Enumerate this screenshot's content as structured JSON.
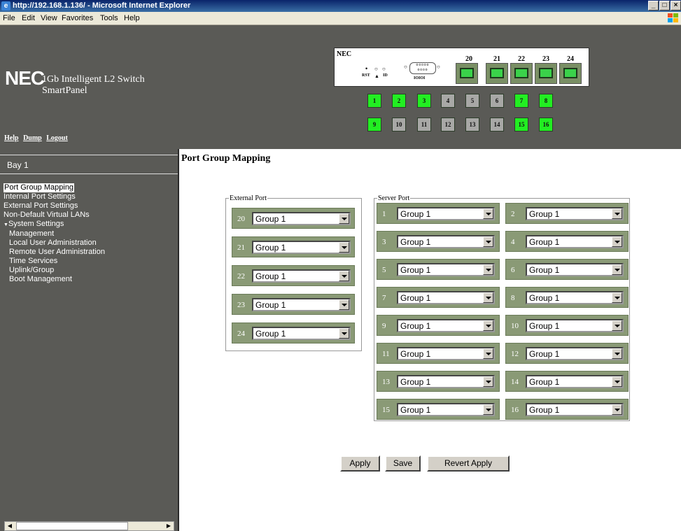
{
  "window": {
    "title": "http://192.168.1.136/ - Microsoft Internet Explorer",
    "min": "_",
    "max": "□",
    "close": "×"
  },
  "menu": [
    "File",
    "Edit",
    "View",
    "Favorites",
    "Tools",
    "Help"
  ],
  "header": {
    "logo": "NEC",
    "product_line1": "1Gb Intelligent L2 Switch",
    "product_line2": "SmartPanel",
    "links": [
      "Help",
      "Dump",
      "Logout"
    ]
  },
  "panel": {
    "brand": "NEC",
    "rst": "RST",
    "id": "ID",
    "serial_text": "IOIOI",
    "external_ports": [
      "20",
      "21",
      "22",
      "23",
      "24"
    ],
    "server_ports": [
      {
        "n": "1",
        "up": true
      },
      {
        "n": "2",
        "up": true
      },
      {
        "n": "3",
        "up": true
      },
      {
        "n": "4",
        "up": false
      },
      {
        "n": "5",
        "up": false
      },
      {
        "n": "6",
        "up": false
      },
      {
        "n": "7",
        "up": true
      },
      {
        "n": "8",
        "up": true
      },
      {
        "n": "9",
        "up": true
      },
      {
        "n": "10",
        "up": false
      },
      {
        "n": "11",
        "up": false
      },
      {
        "n": "12",
        "up": false
      },
      {
        "n": "13",
        "up": false
      },
      {
        "n": "14",
        "up": false
      },
      {
        "n": "15",
        "up": true
      },
      {
        "n": "16",
        "up": true
      }
    ],
    "colors": {
      "link_up": "#22ee22",
      "link_down": "#a8a8a6"
    }
  },
  "sidebar": {
    "bay": "Bay 1",
    "items": [
      {
        "label": "Port Group Mapping",
        "selected": true
      },
      {
        "label": "Internal Port Settings"
      },
      {
        "label": "External Port Settings"
      },
      {
        "label": "Non-Default Virtual LANs"
      },
      {
        "label": "System Settings",
        "expanded": true
      },
      {
        "label": "Management",
        "sub": true
      },
      {
        "label": "Local User Administration",
        "sub": true
      },
      {
        "label": "Remote User Administration",
        "sub": true
      },
      {
        "label": "Time Services",
        "sub": true
      },
      {
        "label": "Uplink/Group",
        "sub": true
      },
      {
        "label": "Boot Management",
        "sub": true
      }
    ]
  },
  "main": {
    "title": "Port Group Mapping",
    "external_legend": "External Port",
    "server_legend": "Server Port",
    "external": [
      {
        "port": "20",
        "group": "Group 1"
      },
      {
        "port": "21",
        "group": "Group 1"
      },
      {
        "port": "22",
        "group": "Group 1"
      },
      {
        "port": "23",
        "group": "Group 1"
      },
      {
        "port": "24",
        "group": "Group 1"
      }
    ],
    "server": [
      {
        "port": "1",
        "group": "Group 1"
      },
      {
        "port": "2",
        "group": "Group 1"
      },
      {
        "port": "3",
        "group": "Group 1"
      },
      {
        "port": "4",
        "group": "Group 1"
      },
      {
        "port": "5",
        "group": "Group 1"
      },
      {
        "port": "6",
        "group": "Group 1"
      },
      {
        "port": "7",
        "group": "Group 1"
      },
      {
        "port": "8",
        "group": "Group 1"
      },
      {
        "port": "9",
        "group": "Group 1"
      },
      {
        "port": "10",
        "group": "Group 1"
      },
      {
        "port": "11",
        "group": "Group 1"
      },
      {
        "port": "12",
        "group": "Group 1"
      },
      {
        "port": "13",
        "group": "Group 1"
      },
      {
        "port": "14",
        "group": "Group 1"
      },
      {
        "port": "15",
        "group": "Group 1"
      },
      {
        "port": "16",
        "group": "Group 1"
      }
    ],
    "buttons": {
      "apply": "Apply",
      "save": "Save",
      "revert": "Revert Apply"
    }
  }
}
